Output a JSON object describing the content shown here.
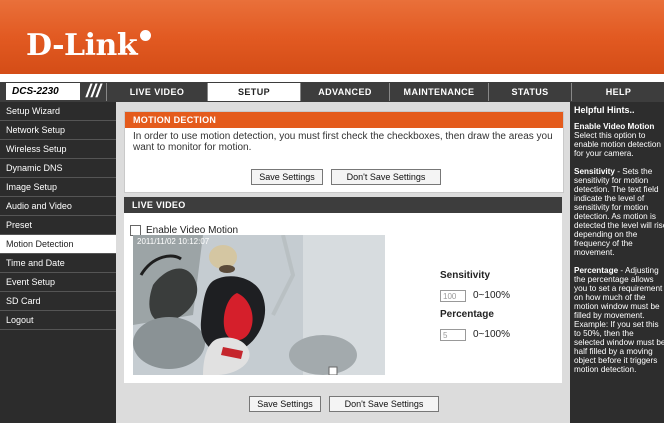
{
  "header": {
    "logo": "D-Link"
  },
  "nav": {
    "model": "DCS-2230",
    "slashes": "///",
    "tabs": [
      {
        "label": "LIVE VIDEO"
      },
      {
        "label": "SETUP"
      },
      {
        "label": "ADVANCED"
      },
      {
        "label": "MAINTENANCE"
      },
      {
        "label": "STATUS"
      },
      {
        "label": "HELP"
      }
    ],
    "active_tab": "SETUP"
  },
  "sidebar": {
    "items": [
      {
        "label": "Setup Wizard"
      },
      {
        "label": "Network Setup"
      },
      {
        "label": "Wireless Setup"
      },
      {
        "label": "Dynamic DNS"
      },
      {
        "label": "Image Setup"
      },
      {
        "label": "Audio and Video"
      },
      {
        "label": "Preset"
      },
      {
        "label": "Motion Detection"
      },
      {
        "label": "Time and Date"
      },
      {
        "label": "Event Setup"
      },
      {
        "label": "SD Card"
      },
      {
        "label": "Logout"
      }
    ],
    "active_item": "Motion Detection"
  },
  "motion": {
    "title": "MOTION DECTION",
    "intro": "In order to use motion detection, you must first check the checkboxes, then draw the areas you want to monitor for motion.",
    "save_label": "Save Settings",
    "dont_save_label": "Don't Save Settings"
  },
  "live": {
    "title": "LIVE VIDEO",
    "enable_label": "Enable Video Motion",
    "enabled": false,
    "timestamp": "2011/11/02 10:12:07",
    "sensitivity_label": "Sensitivity",
    "sensitivity_value": "100",
    "sensitivity_range": "0~100%",
    "percentage_label": "Percentage",
    "percentage_value": "5",
    "percentage_range": "0~100%"
  },
  "footer": {
    "save_label": "Save Settings",
    "dont_save_label": "Don't Save Settings"
  },
  "help": {
    "title": "Helpful Hints..",
    "lines": [
      "Select this option to",
      "enable motion detection",
      "for your camera.",
      "sensitivity for motion",
      "detection. The text field",
      "indicate the level of",
      "sensitivity for motion",
      "detection. As motion is",
      "detected the level will rise",
      "depending on the",
      "frequency of the",
      "movement.",
      "the percentage allows",
      "you to set a requirement",
      "on how much of the",
      "motion window must be",
      "filled by movement.",
      "Example: If you set this",
      "to 50%, then the",
      "selected window must be",
      "half filled by a moving",
      "object before it triggers",
      "motion detection."
    ],
    "head_enable": "Enable Video Motion",
    "head_sensitivity": "Sensitivity",
    "sensitivity_tail": " - Sets the",
    "head_percentage": "Percentage",
    "percentage_tail": " - Adjusting"
  },
  "colors": {
    "brand_orange": "#e45b1c",
    "nav_dark": "#3d3d3d",
    "sidebar_dark": "#2c2c2c"
  }
}
